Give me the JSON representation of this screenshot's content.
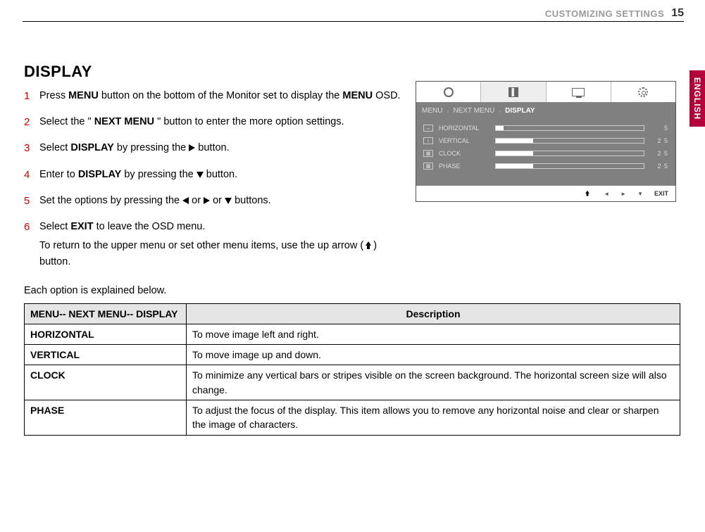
{
  "header": {
    "title": "CUSTOMIZING SETTINGS",
    "page_number": "15"
  },
  "lang_tab": "ENGLISH",
  "section_title": "DISPLAY",
  "steps": [
    {
      "n": "1",
      "html": "Press <b>MENU</b> button on the bottom of the Monitor set to display  the <b>MENU</b> OSD."
    },
    {
      "n": "2",
      "html": "Select the \" <b>NEXT MENU</b> \" button to enter the more option settings."
    },
    {
      "n": "3",
      "html": "Select <b>DISPLAY</b> by pressing the <span class='tri tri-right'></span> button."
    },
    {
      "n": "4",
      "html": "Enter to <b>DISPLAY</b> by pressing the <span class='tri tri-down'></span> button."
    },
    {
      "n": "5",
      "html": "Set the options by pressing the <span class='tri tri-left'></span> or <span class='tri tri-right'></span> or <span class='tri tri-down'></span> buttons."
    },
    {
      "n": "6",
      "html": "Select <b>EXIT</b> to leave the OSD menu."
    }
  ],
  "step6_sub": "To return to the upper menu or set other menu items, use the up arrow (<span class='up-icon'></span>) button.",
  "each_explained": "Each option is explained below.",
  "osd": {
    "breadcrumb": [
      "MENU",
      "NEXT MENU",
      "DISPLAY"
    ],
    "rows": [
      {
        "label": "HORIZONTAL",
        "value": "5",
        "fill": 5
      },
      {
        "label": "VERTICAL",
        "value": "2 5",
        "fill": 25
      },
      {
        "label": "CLOCK",
        "value": "2 5",
        "fill": 25
      },
      {
        "label": "PHASE",
        "value": "2 5",
        "fill": 25
      }
    ],
    "footer_exit": "EXIT"
  },
  "table": {
    "header_left": "MENU-- NEXT MENU-- DISPLAY",
    "header_right": "Description",
    "rows": [
      {
        "name": "HORIZONTAL",
        "desc": "To move image left and right."
      },
      {
        "name": "VERTICAL",
        "desc": "To move image up and down."
      },
      {
        "name": "CLOCK",
        "desc": "To minimize any vertical bars or stripes visible on the screen background. The horizontal screen size will also change."
      },
      {
        "name": "PHASE",
        "desc": "To adjust the focus of the display. This item allows you to remove any horizontal noise and clear or sharpen the image of characters."
      }
    ]
  }
}
